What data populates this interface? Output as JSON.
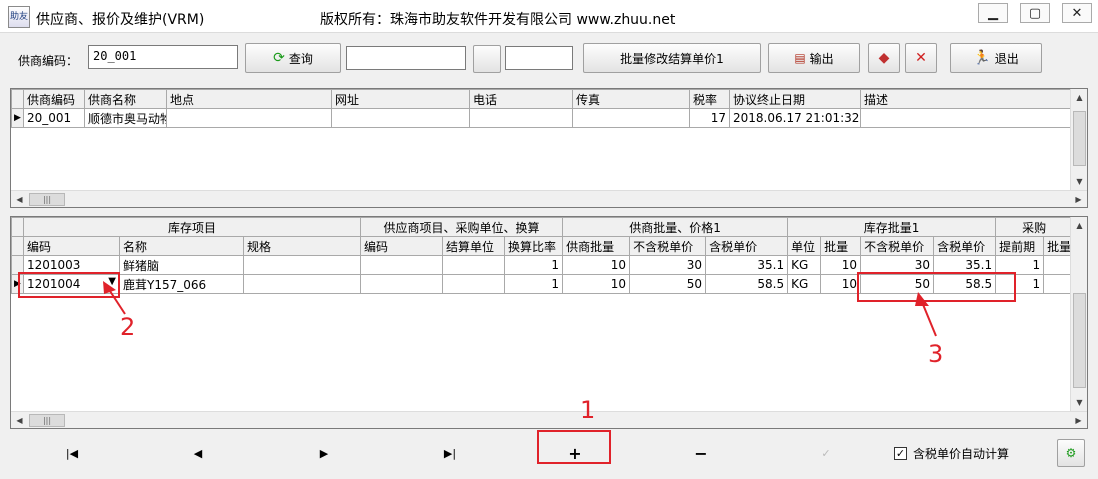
{
  "window": {
    "app_icon_text": "助友",
    "title": "供应商、报价及维护(VRM)",
    "copyright": "版权所有：珠海市助友软件开发有限公司 www.zhuu.net",
    "minimize": "▭",
    "restore": "□",
    "close": "✕"
  },
  "toolbar": {
    "supplier_code_label": "供商编码：",
    "supplier_code_value": "20_001",
    "query_label": "查询",
    "field2_value": "",
    "field3_value": "",
    "batch_label": "批量修改结算单价1",
    "export_label": "输出",
    "exit_label": "退出"
  },
  "supplier_grid": {
    "headers": [
      "供商编码",
      "供商名称",
      "地点",
      "网址",
      "电话",
      "传真",
      "税率",
      "协议终止日期",
      "描述"
    ],
    "rows": [
      {
        "code": "20_001",
        "name": "顺德市奥马动物",
        "location": "",
        "url": "",
        "phone": "",
        "fax": "",
        "tax": "17",
        "end_date": "2018.06.17 21:01:32",
        "desc": ""
      }
    ]
  },
  "items_grid": {
    "group_headers": [
      "库存项目",
      "供应商项目、采购单位、换算",
      "供商批量、价格1",
      "库存批量1",
      "采购"
    ],
    "headers": [
      "编码",
      "名称",
      "规格",
      "编码",
      "结算单位",
      "换算比率",
      "供商批量",
      "不含税单价",
      "含税单价",
      "单位",
      "批量",
      "不含税单价",
      "含税单价",
      "提前期",
      "批量"
    ],
    "rows": [
      {
        "code": "1201003",
        "name": "鲜猪脑",
        "spec": "",
        "sup_code": "",
        "settle_unit": "",
        "ratio": "1",
        "sup_batch": "10",
        "price_ex": "30",
        "price_in": "35.1",
        "unit": "KG",
        "batch": "10",
        "st_price_ex": "30",
        "st_price_in": "35.1",
        "lead": "1",
        "p_batch": ""
      },
      {
        "code": "1201004",
        "name": "鹿茸Y157_066",
        "spec": "",
        "sup_code": "",
        "settle_unit": "",
        "ratio": "1",
        "sup_batch": "10",
        "price_ex": "50",
        "price_in": "58.5",
        "unit": "KG",
        "batch": "10",
        "st_price_ex": "50",
        "st_price_in": "58.5",
        "lead": "1",
        "p_batch": ""
      }
    ]
  },
  "navbar": {
    "first": "|◀",
    "prev": "◀",
    "next": "▶",
    "last": "▶|",
    "add": "+",
    "remove": "−",
    "post": "✓",
    "auto_calc_label": "含税单价自动计算",
    "auto_calc_checked": true
  },
  "annotations": {
    "a1": "1",
    "a2": "2",
    "a3": "3"
  },
  "colors": {
    "annotation": "#e0222a",
    "accent_green": "#2a9a2a"
  }
}
